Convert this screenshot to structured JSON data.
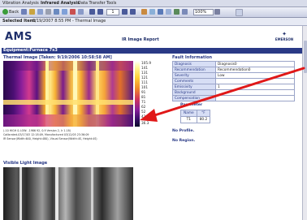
{
  "menu": {
    "tabs": [
      "Vibration Analysis",
      "Infrared Analysis",
      "Data Transfer",
      "Tools"
    ]
  },
  "toolbar": {
    "back_label": "Back",
    "page_current": "1",
    "zoom": "100%"
  },
  "selected": {
    "label": "Selected Item:",
    "value": "3/19/2007 8:55 PM - Thermal Image"
  },
  "report": {
    "logo": "AMS",
    "title": "IR Image Report",
    "brand": "EMERSON",
    "equipment": "Equipment:Furnace 7x3"
  },
  "thermal": {
    "title": "Thermal Image [Taken: 9/19/2006 10:58:58 AM]",
    "scale_labels": [
      "105.9",
      "141",
      "131",
      "121",
      "111",
      "101",
      "91",
      "81",
      "71",
      "62",
      "52",
      "42",
      "36.3"
    ],
    "meta_lines": [
      "(-10 HIGH & LOW: -1986 92, 0.9 Version 2, Ir 1.18)",
      "Calibrated-03/17/03 12:18:09, Manufactured 03/12/05 23:36:09",
      "IR Sensor(Width:640, Height:480), Visual Sensor(Width:4S, Height:4S)"
    ]
  },
  "visible": {
    "title": "Visible Light Image"
  },
  "fault": {
    "title": "Fault Information",
    "rows": [
      {
        "key": "Diagnosis",
        "value": "Diagnosis0"
      },
      {
        "key": "Recommendation",
        "value": "Recommendation0"
      },
      {
        "key": "Severity",
        "value": "Low"
      },
      {
        "key": "Comments",
        "value": ""
      },
      {
        "key": "Emissivity",
        "value": "1"
      },
      {
        "key": "Background",
        "value": ""
      },
      {
        "key": "Compensation",
        "value": ""
      }
    ],
    "parameter_title": "Parameter",
    "param_headers": [
      "Name",
      "°F"
    ],
    "param_row": [
      "T1",
      "80.2"
    ],
    "no_profile": "No Profile.",
    "no_region": "No Region."
  },
  "colors": {
    "nav_blue": "#2a3a86",
    "annotation_red": "#e01818"
  }
}
